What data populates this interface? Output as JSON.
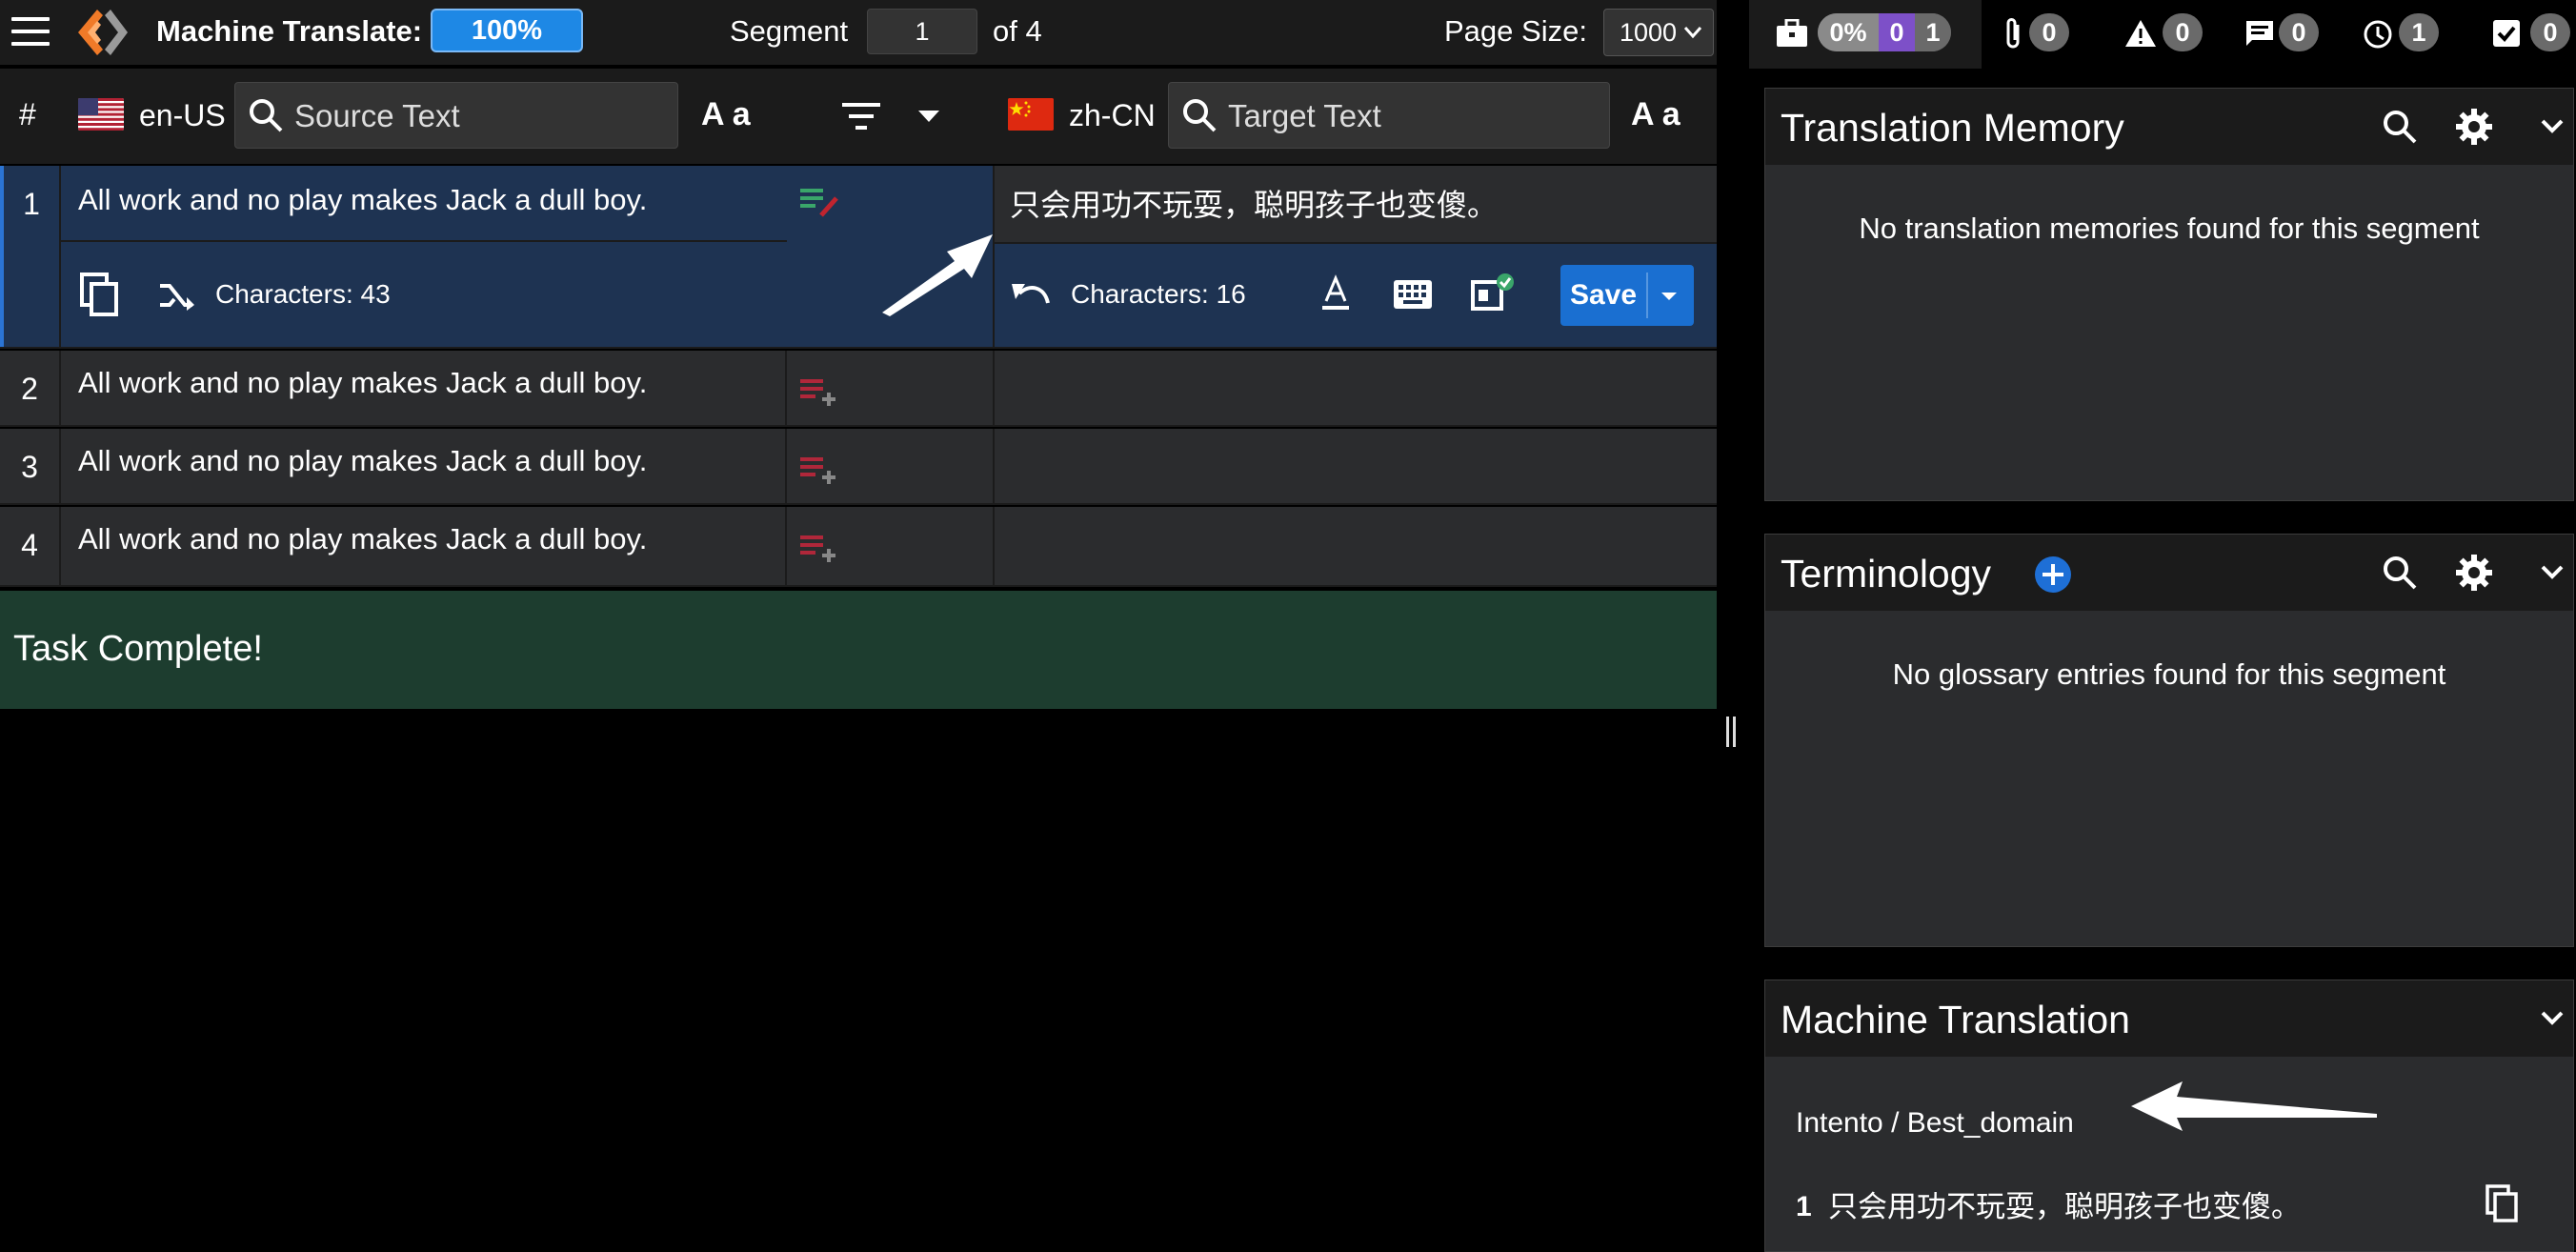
{
  "toolbar": {
    "app_label": "Machine Translate:",
    "progress": "100%",
    "segment_label": "Segment",
    "segment_value": "1",
    "segment_of": "of 4",
    "page_size_label": "Page Size:",
    "page_size_value": "1000"
  },
  "header": {
    "hash": "#",
    "source_lang": "en-US",
    "source_search_placeholder": "Source Text",
    "target_lang": "zh-CN",
    "target_search_placeholder": "Target Text",
    "font_size_label": "A a"
  },
  "segments": [
    {
      "num": "1",
      "source": "All work and no play makes Jack a dull boy.",
      "target": "只会用功不玩耍，聪明孩子也变傻。",
      "source_chars": "Characters: 43",
      "target_chars": "Characters: 16",
      "status": "translated"
    },
    {
      "num": "2",
      "source": "All work and no play makes Jack a dull boy.",
      "target": "",
      "status": "untranslated"
    },
    {
      "num": "3",
      "source": "All work and no play makes Jack a dull boy.",
      "target": "",
      "status": "untranslated"
    },
    {
      "num": "4",
      "source": "All work and no play makes Jack a dull boy.",
      "target": "",
      "status": "untranslated"
    }
  ],
  "editor": {
    "save_label": "Save"
  },
  "task_complete": "Task Complete!",
  "status_bar": {
    "progress_pct": "0%",
    "progress_a": "0",
    "progress_b": "1",
    "attachments": "0",
    "warnings": "0",
    "comments": "0",
    "history": "1",
    "checks": "0"
  },
  "translation_memory": {
    "title": "Translation Memory",
    "empty": "No translation memories found for this segment"
  },
  "terminology": {
    "title": "Terminology",
    "empty": "No glossary entries found for this segment"
  },
  "machine_translation": {
    "title": "Machine Translation",
    "engine": "Intento / Best_domain",
    "result_num": "1",
    "result_text": "只会用功不玩耍，聪明孩子也变傻。"
  },
  "colors": {
    "accent": "#1e88e5",
    "active_row": "#1e3352",
    "task_complete_bg": "#1d3d2f",
    "status_untranslated": "#b0273a",
    "status_translated": "#3aa66a"
  }
}
